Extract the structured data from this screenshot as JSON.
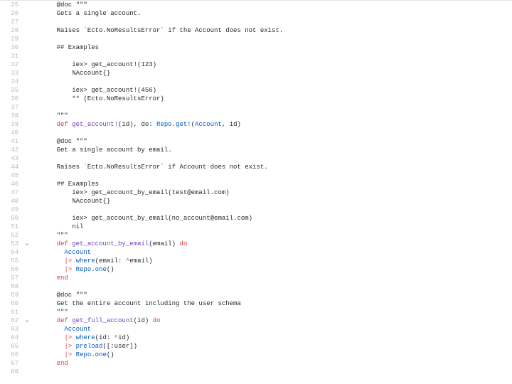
{
  "lines": [
    {
      "num": 25,
      "fold": "",
      "tokens": [
        {
          "cls": "cm",
          "t": "    @doc \"\"\""
        }
      ]
    },
    {
      "num": 26,
      "fold": "",
      "tokens": [
        {
          "cls": "cm",
          "t": "    Gets a single account."
        }
      ]
    },
    {
      "num": 27,
      "fold": "",
      "tokens": [
        {
          "cls": "cm",
          "t": ""
        }
      ]
    },
    {
      "num": 28,
      "fold": "",
      "tokens": [
        {
          "cls": "cm",
          "t": "    Raises `Ecto.NoResultsError` if the Account does not exist."
        }
      ]
    },
    {
      "num": 29,
      "fold": "",
      "tokens": [
        {
          "cls": "cm",
          "t": ""
        }
      ]
    },
    {
      "num": 30,
      "fold": "",
      "tokens": [
        {
          "cls": "cm",
          "t": "    ## Examples"
        }
      ]
    },
    {
      "num": 31,
      "fold": "",
      "tokens": [
        {
          "cls": "cm",
          "t": ""
        }
      ]
    },
    {
      "num": 32,
      "fold": "",
      "tokens": [
        {
          "cls": "cm",
          "t": "        iex> get_account!(123)"
        }
      ]
    },
    {
      "num": 33,
      "fold": "",
      "tokens": [
        {
          "cls": "cm",
          "t": "        %Account{}"
        }
      ]
    },
    {
      "num": 34,
      "fold": "",
      "tokens": [
        {
          "cls": "cm",
          "t": ""
        }
      ]
    },
    {
      "num": 35,
      "fold": "",
      "tokens": [
        {
          "cls": "cm",
          "t": "        iex> get_account!(456)"
        }
      ]
    },
    {
      "num": 36,
      "fold": "",
      "tokens": [
        {
          "cls": "cm",
          "t": "        ** (Ecto.NoResultsError)"
        }
      ]
    },
    {
      "num": 37,
      "fold": "",
      "tokens": [
        {
          "cls": "cm",
          "t": ""
        }
      ]
    },
    {
      "num": 38,
      "fold": "",
      "tokens": [
        {
          "cls": "cm",
          "t": "    \"\"\""
        }
      ]
    },
    {
      "num": 39,
      "fold": "",
      "tokens": [
        {
          "cls": "var",
          "t": "    "
        },
        {
          "cls": "kw",
          "t": "def"
        },
        {
          "cls": "var",
          "t": " "
        },
        {
          "cls": "fn",
          "t": "get_account!"
        },
        {
          "cls": "paren",
          "t": "(id), "
        },
        {
          "cls": "atom",
          "t": "do: "
        },
        {
          "cls": "mod2",
          "t": "Repo"
        },
        {
          "cls": "var",
          "t": "."
        },
        {
          "cls": "call",
          "t": "get!"
        },
        {
          "cls": "paren",
          "t": "("
        },
        {
          "cls": "mod2",
          "t": "Account"
        },
        {
          "cls": "paren",
          "t": ", id)"
        }
      ]
    },
    {
      "num": 40,
      "fold": "",
      "tokens": [
        {
          "cls": "cm",
          "t": ""
        }
      ]
    },
    {
      "num": 41,
      "fold": "",
      "tokens": [
        {
          "cls": "cm",
          "t": "    @doc \"\"\""
        }
      ]
    },
    {
      "num": 42,
      "fold": "",
      "tokens": [
        {
          "cls": "cm",
          "t": "    Get a single account by email."
        }
      ]
    },
    {
      "num": 43,
      "fold": "",
      "tokens": [
        {
          "cls": "cm",
          "t": ""
        }
      ]
    },
    {
      "num": 44,
      "fold": "",
      "tokens": [
        {
          "cls": "cm",
          "t": "    Raises `Ecto.NoResultsError` if Account does not exist."
        }
      ]
    },
    {
      "num": 45,
      "fold": "",
      "tokens": [
        {
          "cls": "cm",
          "t": ""
        }
      ]
    },
    {
      "num": 46,
      "fold": "",
      "tokens": [
        {
          "cls": "cm",
          "t": "    ## Examples"
        }
      ]
    },
    {
      "num": 47,
      "fold": "",
      "tokens": [
        {
          "cls": "cm",
          "t": "        iex> get_account_by_email(test@email.com)"
        }
      ]
    },
    {
      "num": 48,
      "fold": "",
      "tokens": [
        {
          "cls": "cm",
          "t": "        %Account{}"
        }
      ]
    },
    {
      "num": 49,
      "fold": "",
      "tokens": [
        {
          "cls": "cm",
          "t": ""
        }
      ]
    },
    {
      "num": 50,
      "fold": "",
      "tokens": [
        {
          "cls": "cm",
          "t": "        iex> get_account_by_email(no_account@email.com)"
        }
      ]
    },
    {
      "num": 51,
      "fold": "",
      "tokens": [
        {
          "cls": "cm",
          "t": "        nil"
        }
      ]
    },
    {
      "num": 52,
      "fold": "",
      "tokens": [
        {
          "cls": "cm",
          "t": "    \"\"\""
        }
      ]
    },
    {
      "num": 53,
      "fold": "⌄",
      "tokens": [
        {
          "cls": "var",
          "t": "    "
        },
        {
          "cls": "kw",
          "t": "def"
        },
        {
          "cls": "var",
          "t": " "
        },
        {
          "cls": "fn",
          "t": "get_account_by_email"
        },
        {
          "cls": "paren",
          "t": "(email) "
        },
        {
          "cls": "kw",
          "t": "do"
        }
      ]
    },
    {
      "num": 54,
      "fold": "",
      "tokens": [
        {
          "cls": "var",
          "t": "      "
        },
        {
          "cls": "mod2",
          "t": "Account"
        }
      ]
    },
    {
      "num": 55,
      "fold": "",
      "tokens": [
        {
          "cls": "var",
          "t": "      "
        },
        {
          "cls": "pipe",
          "t": "|>"
        },
        {
          "cls": "var",
          "t": " "
        },
        {
          "cls": "call",
          "t": "where"
        },
        {
          "cls": "paren",
          "t": "("
        },
        {
          "cls": "atom",
          "t": "email: "
        },
        {
          "cls": "pipe",
          "t": "^"
        },
        {
          "cls": "var",
          "t": "email"
        },
        {
          "cls": "paren",
          "t": ")"
        }
      ]
    },
    {
      "num": 56,
      "fold": "",
      "tokens": [
        {
          "cls": "var",
          "t": "      "
        },
        {
          "cls": "pipe",
          "t": "|>"
        },
        {
          "cls": "var",
          "t": " "
        },
        {
          "cls": "mod2",
          "t": "Repo"
        },
        {
          "cls": "var",
          "t": "."
        },
        {
          "cls": "call",
          "t": "one"
        },
        {
          "cls": "paren",
          "t": "()"
        }
      ]
    },
    {
      "num": 57,
      "fold": "",
      "tokens": [
        {
          "cls": "var",
          "t": "    "
        },
        {
          "cls": "kw",
          "t": "end"
        }
      ]
    },
    {
      "num": 58,
      "fold": "",
      "tokens": [
        {
          "cls": "cm",
          "t": ""
        }
      ]
    },
    {
      "num": 59,
      "fold": "",
      "tokens": [
        {
          "cls": "cm",
          "t": "    @doc \"\"\""
        }
      ]
    },
    {
      "num": 60,
      "fold": "",
      "tokens": [
        {
          "cls": "cm",
          "t": "    Get the entire account including the user schema"
        }
      ]
    },
    {
      "num": 61,
      "fold": "",
      "tokens": [
        {
          "cls": "cm",
          "t": "    \"\"\""
        }
      ]
    },
    {
      "num": 62,
      "fold": "⌄",
      "tokens": [
        {
          "cls": "var",
          "t": "    "
        },
        {
          "cls": "kw",
          "t": "def"
        },
        {
          "cls": "var",
          "t": " "
        },
        {
          "cls": "fn",
          "t": "get_full_account"
        },
        {
          "cls": "paren",
          "t": "(id) "
        },
        {
          "cls": "kw",
          "t": "do"
        }
      ]
    },
    {
      "num": 63,
      "fold": "",
      "tokens": [
        {
          "cls": "var",
          "t": "      "
        },
        {
          "cls": "mod2",
          "t": "Account"
        }
      ]
    },
    {
      "num": 64,
      "fold": "",
      "tokens": [
        {
          "cls": "var",
          "t": "      "
        },
        {
          "cls": "pipe",
          "t": "|>"
        },
        {
          "cls": "var",
          "t": " "
        },
        {
          "cls": "call",
          "t": "where"
        },
        {
          "cls": "paren",
          "t": "("
        },
        {
          "cls": "atom",
          "t": "id: "
        },
        {
          "cls": "pipe",
          "t": "^"
        },
        {
          "cls": "var",
          "t": "id"
        },
        {
          "cls": "paren",
          "t": ")"
        }
      ]
    },
    {
      "num": 65,
      "fold": "",
      "tokens": [
        {
          "cls": "var",
          "t": "      "
        },
        {
          "cls": "pipe",
          "t": "|>"
        },
        {
          "cls": "var",
          "t": " "
        },
        {
          "cls": "call",
          "t": "preload"
        },
        {
          "cls": "paren",
          "t": "(["
        },
        {
          "cls": "atom",
          "t": ":user"
        },
        {
          "cls": "paren",
          "t": "])"
        }
      ]
    },
    {
      "num": 66,
      "fold": "",
      "tokens": [
        {
          "cls": "var",
          "t": "      "
        },
        {
          "cls": "pipe",
          "t": "|>"
        },
        {
          "cls": "var",
          "t": " "
        },
        {
          "cls": "mod2",
          "t": "Repo"
        },
        {
          "cls": "var",
          "t": "."
        },
        {
          "cls": "call",
          "t": "one"
        },
        {
          "cls": "paren",
          "t": "()"
        }
      ]
    },
    {
      "num": 67,
      "fold": "",
      "tokens": [
        {
          "cls": "var",
          "t": "    "
        },
        {
          "cls": "kw",
          "t": "end"
        }
      ]
    },
    {
      "num": 68,
      "fold": "",
      "tokens": [
        {
          "cls": "cm",
          "t": ""
        }
      ]
    }
  ]
}
